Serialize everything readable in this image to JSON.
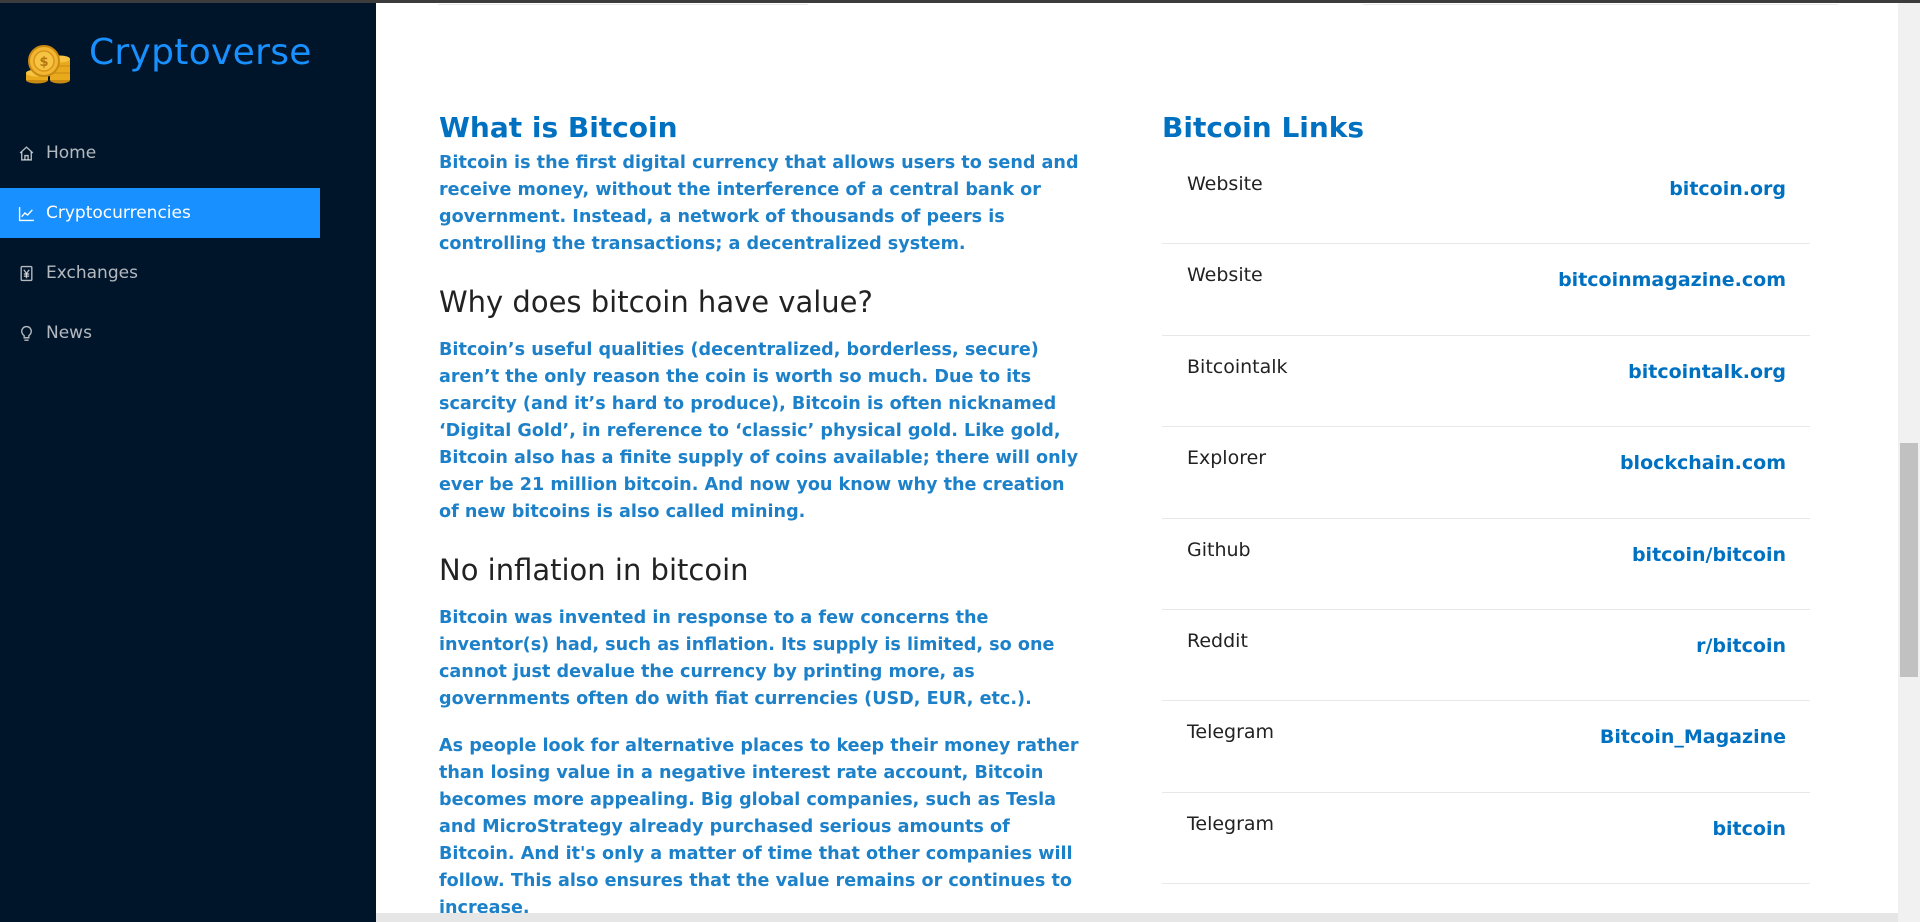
{
  "app": {
    "title": "Cryptoverse"
  },
  "sidebar": {
    "items": [
      {
        "label": "Home",
        "icon": "home-icon",
        "selected": false
      },
      {
        "label": "Cryptocurrencies",
        "icon": "line-chart-icon",
        "selected": true
      },
      {
        "label": "Exchanges",
        "icon": "money-collect-icon",
        "selected": false
      },
      {
        "label": "News",
        "icon": "bulb-icon",
        "selected": false
      }
    ]
  },
  "colors": {
    "sidebar_bg": "#001529",
    "accent": "#1890ff",
    "heading_blue": "#0071c1",
    "text_blue": "#1d81c9"
  },
  "main": {
    "what_is": {
      "title": "What is Bitcoin",
      "text": "Bitcoin is the first digital currency that allows users to send and receive money, without the interference of a central bank or government. Instead, a network of thousands of peers is controlling the transactions; a decentralized system."
    },
    "why_value": {
      "title": "Why does bitcoin have value?",
      "text": "Bitcoin’s useful qualities (decentralized, borderless, secure) aren’t the only reason the coin is worth so much. Due to its scarcity (and it’s hard to produce), Bitcoin is often nicknamed ‘Digital Gold’, in reference to ‘classic’ physical gold. Like gold, Bitcoin also has a finite supply of coins available; there will only ever be 21 million bitcoin. And now you know why the creation of new bitcoins is also called mining."
    },
    "no_inflation": {
      "title": "No inflation in bitcoin",
      "text1": "Bitcoin was invented in response to a few concerns the inventor(s) had, such as inflation. Its supply is limited, so one cannot just devalue the currency by printing more, as governments often do with fiat currencies (USD, EUR, etc.).",
      "text2": "As people look for alternative places to keep their money rather than losing value in a negative interest rate account, Bitcoin becomes more appealing. Big global companies, such as Tesla and MicroStrategy already purchased serious amounts of Bitcoin. And it's only a matter of time that other companies will follow. This also ensures that the value remains or continues to increase."
    },
    "links": {
      "title": "Bitcoin Links",
      "items": [
        {
          "type": "Website",
          "value": "bitcoin.org"
        },
        {
          "type": "Website",
          "value": "bitcoinmagazine.com"
        },
        {
          "type": "Bitcointalk",
          "value": "bitcointalk.org"
        },
        {
          "type": "Explorer",
          "value": "blockchain.com"
        },
        {
          "type": "Github",
          "value": "bitcoin/bitcoin"
        },
        {
          "type": "Reddit",
          "value": "r/bitcoin"
        },
        {
          "type": "Telegram",
          "value": "Bitcoin_Magazine"
        },
        {
          "type": "Telegram",
          "value": "bitcoin"
        }
      ]
    }
  }
}
